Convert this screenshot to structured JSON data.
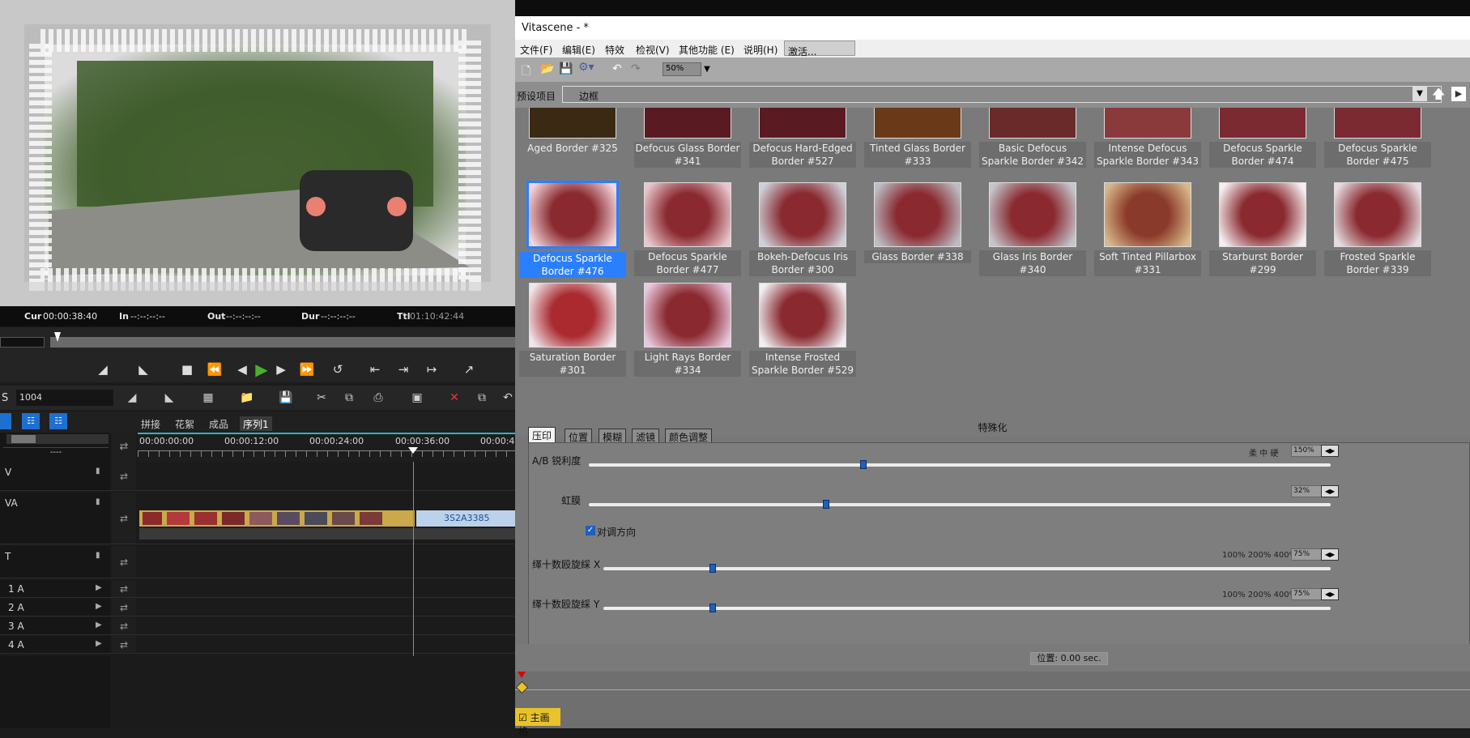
{
  "editor": {
    "preview_alt": "video-preview-frame",
    "timecodes": {
      "cur_label": "Cur",
      "cur": "00:00:38:40",
      "in_label": "In",
      "in": "--:--:--:--",
      "out_label": "Out",
      "out": "--:--:--:--",
      "dur_label": "Dur",
      "dur": "--:--:--:--",
      "ttl_label": "Ttl",
      "ttl": "01:10:42:44"
    },
    "timeline_label": "S",
    "timeline_value": "1004",
    "tabs": [
      "拼接",
      "花絮",
      "成品",
      "序列1"
    ],
    "ruler_ticks": [
      "00:00:00:00",
      "00:00:12:00",
      "00:00:24:00",
      "00:00:36:00",
      "00:00:4"
    ],
    "tracks": [
      {
        "name": "V"
      },
      {
        "name": "VA"
      },
      {
        "name": "T"
      },
      {
        "name": "1 A"
      },
      {
        "name": "2 A"
      },
      {
        "name": "3 A"
      },
      {
        "name": "4 A"
      }
    ],
    "dropdown_value": "----",
    "clip_name": "3S2A3385"
  },
  "vs": {
    "title": "Vitascene - *",
    "menu": [
      "文件(F)",
      "编辑(E)",
      "特效",
      "检视(V)",
      "其他功能 (E)",
      "说明(H)"
    ],
    "activate": "激活...",
    "zoom": "50%",
    "preset_label": "预设项目",
    "preset_value": "边框",
    "top_row": [
      {
        "label": "Aged Border #325"
      },
      {
        "label": "Defocus Glass Border #341"
      },
      {
        "label": "Defocus Hard-Edged Border #527"
      },
      {
        "label": "Tinted Glass Border #333"
      },
      {
        "label": "Basic Defocus Sparkle Border #342"
      },
      {
        "label": "Intense Defocus Sparkle Border #343"
      },
      {
        "label": "Defocus Sparkle Border #474"
      },
      {
        "label": "Defocus Sparkle Border #475"
      }
    ],
    "row2": [
      {
        "label": "Defocus Sparkle Border #476",
        "selected": true
      },
      {
        "label": "Defocus Sparkle Border #477"
      },
      {
        "label": "Bokeh-Defocus Iris Border #300"
      },
      {
        "label": "Glass Border #338"
      },
      {
        "label": "Glass Iris Border #340"
      },
      {
        "label": "Soft Tinted Pillarbox #331"
      },
      {
        "label": "Starburst Border #299"
      },
      {
        "label": "Frosted Sparkle Border #339"
      }
    ],
    "row3": [
      {
        "label": "Saturation Border #301"
      },
      {
        "label": "Light Rays Border #334"
      },
      {
        "label": "Intense Frosted Sparkle Border #529"
      }
    ],
    "special_title": "特殊化",
    "param_tabs": [
      "压印",
      "位置",
      "模糊",
      "滤镜",
      "颜色调整"
    ],
    "params": {
      "sharp_label": "A/B  锐利度",
      "sharp_scale": "柔 中 硬",
      "sharp_value": "150%",
      "sharp_level": 0.37,
      "iris_label": "虹膜",
      "iris_value": "32%",
      "iris_level": 0.32,
      "check_label": "对调方向",
      "x_label": "缂十数殴旋綵  X",
      "x_scale": "100%  200%  400%",
      "x_value": "75%",
      "x_level": 0.15,
      "y_label": "缂十数殴旋綵  Y",
      "y_scale": "100%  200%  400%",
      "y_value": "75%",
      "y_level": 0.15
    },
    "position_label": "位置: 0.00 sec.",
    "grid_label": "主画格"
  },
  "colors": {
    "accent": "#2a7fff",
    "clip": "#c9a94a",
    "playhead": "#2bb4c4"
  }
}
